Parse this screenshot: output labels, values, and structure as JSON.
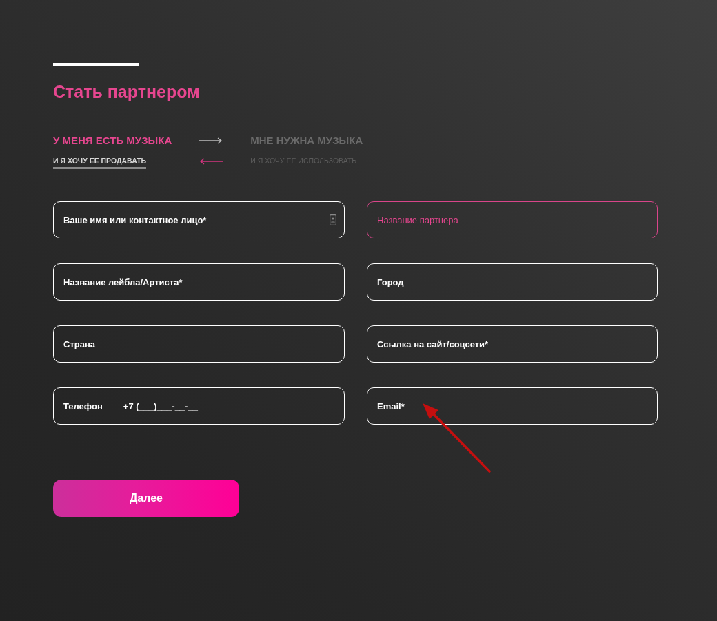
{
  "title": "Стать партнером",
  "tabs": [
    {
      "label": "У МЕНЯ ЕСТЬ МУЗЫКА",
      "sublabel": "И Я ХОЧУ ЕЕ ПРОДАВАТЬ",
      "selected": true
    },
    {
      "label": "МНЕ НУЖНА МУЗЫКА",
      "sublabel": "И Я ХОЧУ ЕЕ ИСПОЛЬЗОВАТЬ",
      "selected": false
    }
  ],
  "fields": [
    {
      "kind": "text",
      "placeholder": "Ваше имя или контактное лицо*",
      "focused": false,
      "autofill_icon": true
    },
    {
      "kind": "text",
      "placeholder": "Название партнера",
      "focused": true,
      "autofill_icon": false
    },
    {
      "kind": "text",
      "placeholder": "Название лейбла/Артиста*",
      "focused": false,
      "autofill_icon": false
    },
    {
      "kind": "text",
      "placeholder": "Город",
      "focused": false,
      "autofill_icon": false
    },
    {
      "kind": "text",
      "placeholder": "Страна",
      "focused": false,
      "autofill_icon": false
    },
    {
      "kind": "text",
      "placeholder": "Ссылка на сайт/соцсети*",
      "focused": false,
      "autofill_icon": false
    },
    {
      "kind": "phone",
      "label": "Телефон",
      "placeholder": "+7 (___)___-__-__",
      "focused": false,
      "autofill_icon": false
    },
    {
      "kind": "text",
      "placeholder": "Email*",
      "focused": false,
      "autofill_icon": false
    }
  ],
  "submit": {
    "label": "Далее"
  }
}
